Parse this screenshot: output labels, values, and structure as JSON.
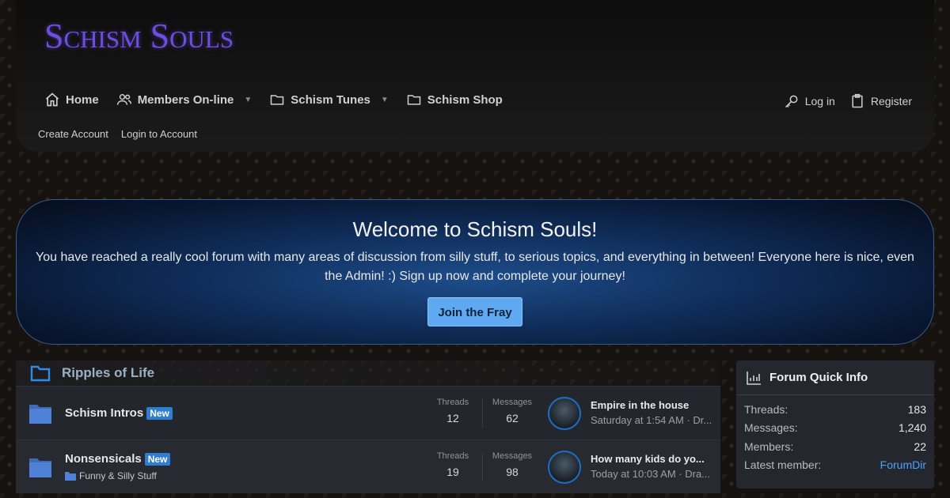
{
  "site": {
    "logo_text": "Schism Souls"
  },
  "nav": {
    "items": [
      {
        "label": "Home",
        "icon": "home-icon"
      },
      {
        "label": "Members On-line",
        "icon": "users-icon",
        "dropdown": true
      },
      {
        "label": "Schism Tunes",
        "icon": "folder-icon",
        "dropdown": true
      },
      {
        "label": "Schism Shop",
        "icon": "folder-icon"
      }
    ],
    "login_label": "Log in",
    "register_label": "Register"
  },
  "subnav": {
    "create_account": "Create Account",
    "login_account": "Login to Account"
  },
  "banner": {
    "title": "Welcome to Schism Souls!",
    "text": "You have reached a really cool forum with many areas of discussion from silly stuff, to serious topics, and everything in between! Everyone here is nice, even the Admin! :) Sign up now and complete your journey!",
    "button": "Join the Fray"
  },
  "category": {
    "title": "Ripples of Life"
  },
  "labels": {
    "threads": "Threads",
    "messages": "Messages",
    "new_badge": "New"
  },
  "forums": [
    {
      "title": "Schism Intros",
      "sub": "",
      "threads": "12",
      "messages": "62",
      "last_title": "Empire in the house",
      "last_meta": "Saturday at 1:54 AM · Dr..."
    },
    {
      "title": "Nonsensicals",
      "sub": "Funny & Silly Stuff",
      "threads": "19",
      "messages": "98",
      "last_title": "How many kids do yo...",
      "last_meta": "Today at 10:03 AM · Dra..."
    }
  ],
  "quick_info": {
    "title": "Forum Quick Info",
    "rows": [
      {
        "k": "Threads:",
        "v": "183"
      },
      {
        "k": "Messages:",
        "v": "1,240"
      },
      {
        "k": "Members:",
        "v": "22"
      },
      {
        "k": "Latest member:",
        "v": "ForumDir"
      }
    ]
  },
  "colors": {
    "accent": "#5ea9f2",
    "logo": "#6b4fe0",
    "link": "#4aa3ff",
    "badge": "#2f7fd0"
  }
}
